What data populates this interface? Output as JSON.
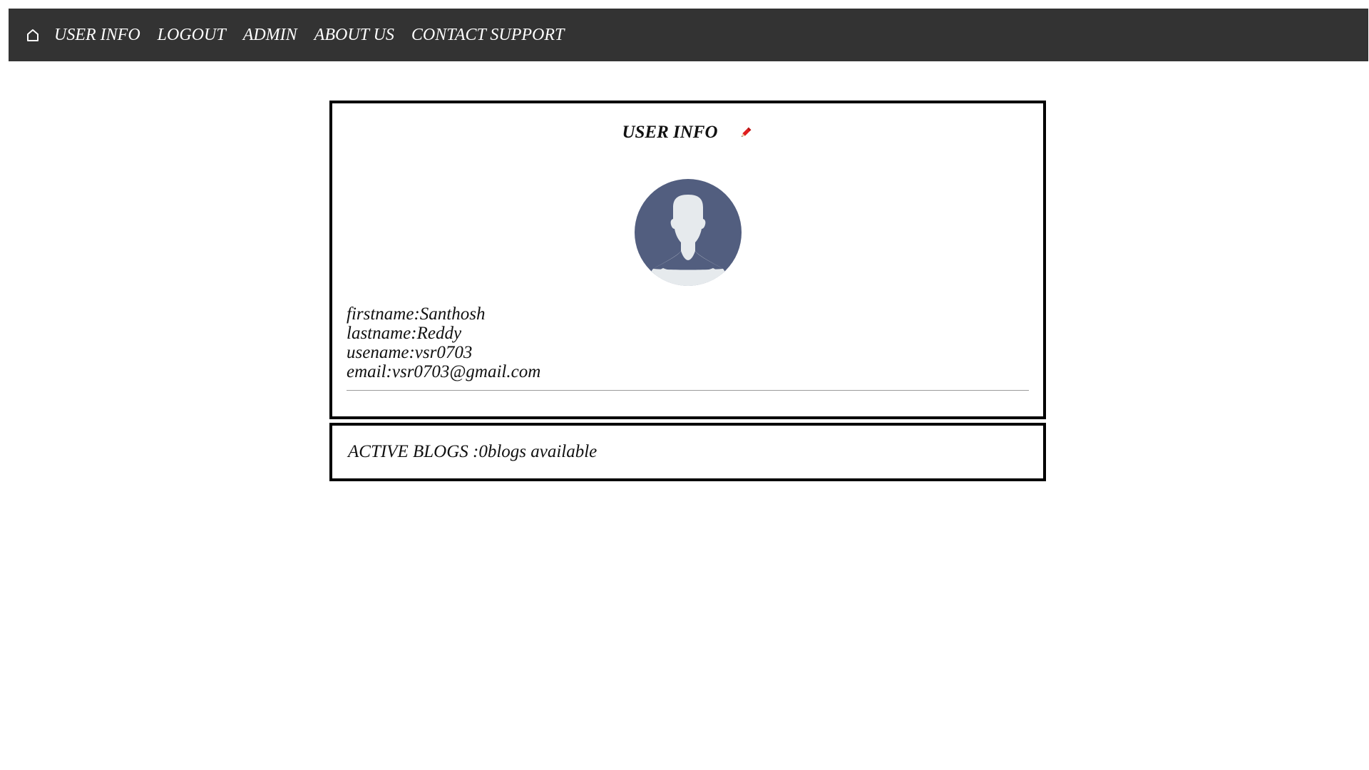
{
  "nav": {
    "home_icon": "home-icon",
    "links": [
      "USER INFO",
      "LOGOUT",
      "ADMIN",
      "ABOUT US",
      "CONTACT SUPPORT"
    ]
  },
  "user_card": {
    "title": "USER INFO",
    "edit_icon": "pencil-icon",
    "avatar_icon": "user-avatar-icon",
    "fields": [
      "firstname:Santhosh",
      "lastname:Reddy",
      "usename:vsr0703",
      "email:vsr0703@gmail.com"
    ]
  },
  "blogs": {
    "text": "ACTIVE BLOGS :0blogs available"
  },
  "colors": {
    "navbar_bg": "#333333",
    "avatar_bg": "#525e7f",
    "avatar_figure": "#e6eaed",
    "edit_icon": "#e02020"
  }
}
